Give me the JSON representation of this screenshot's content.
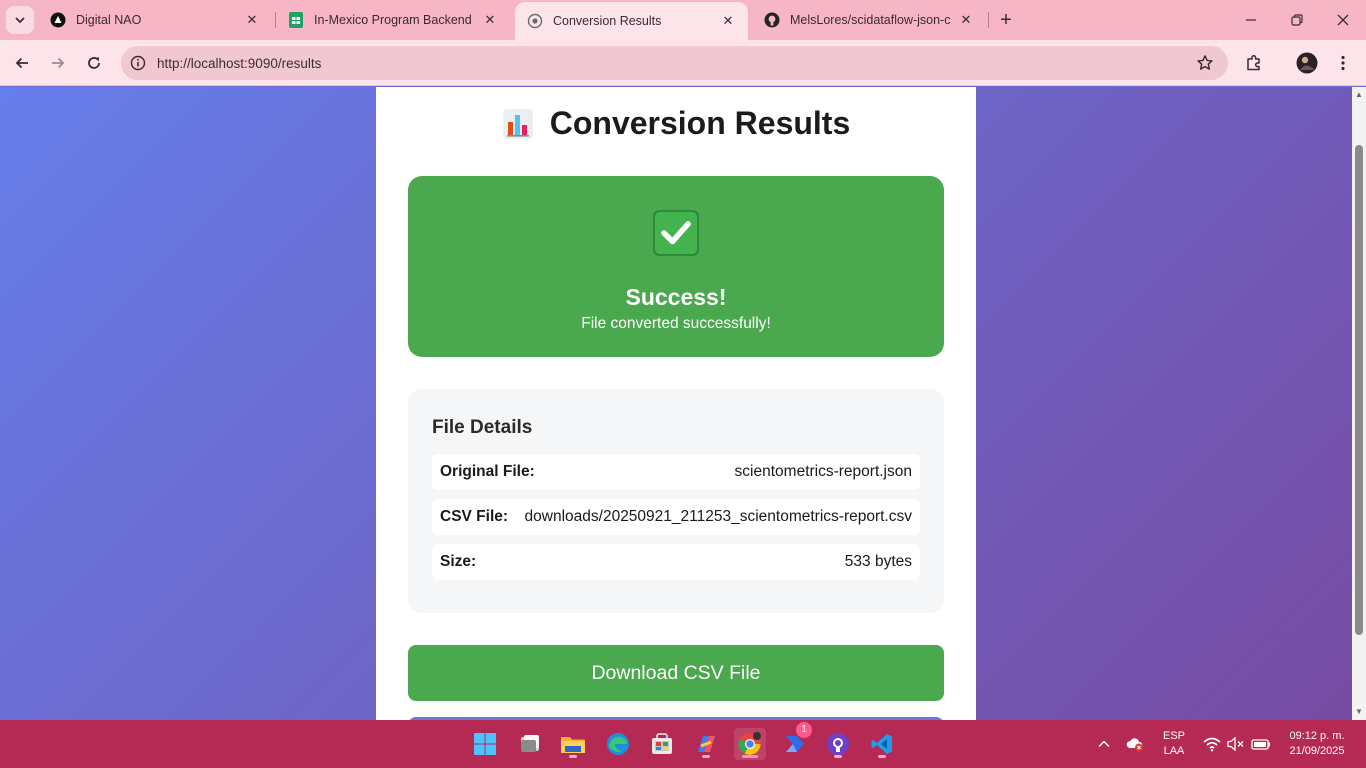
{
  "browser": {
    "tabs": [
      {
        "title": "Digital NAO",
        "active": false
      },
      {
        "title": "In-Mexico Program Backend Gp",
        "active": false
      },
      {
        "title": "Conversion Results",
        "active": true
      },
      {
        "title": "MelsLores/scidataflow-json-csv",
        "active": false
      }
    ],
    "url": "http://localhost:9090/results"
  },
  "page": {
    "title": "Conversion Results",
    "success": {
      "heading": "Success!",
      "message": "File converted successfully!"
    },
    "details": {
      "title": "File Details",
      "rows": [
        {
          "label": "Original File:",
          "value": "scientometrics-report.json"
        },
        {
          "label": "CSV File:",
          "value": "downloads/20250921_211253_scientometrics-report.csv"
        },
        {
          "label": "Size:",
          "value": "533 bytes"
        }
      ]
    },
    "download_label": "Download CSV File"
  },
  "taskbar": {
    "badge_count": "1",
    "language": "ESP",
    "layout": "LAA",
    "time": "09:12 p. m.",
    "date": "21/09/2025"
  },
  "colors": {
    "success_green": "#4aa84e",
    "gradient_start": "#667eea",
    "gradient_end": "#764ba2",
    "taskbar": "#b52a55",
    "tabstrip": "#f7b6c5"
  }
}
